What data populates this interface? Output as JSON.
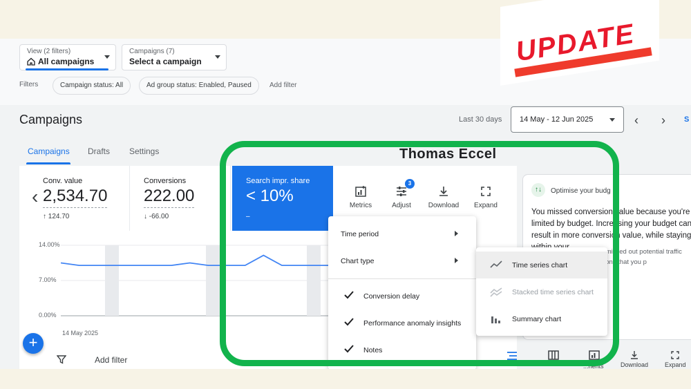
{
  "view_selector": {
    "label": "View (2 filters)",
    "value": "All campaigns"
  },
  "campaign_selector": {
    "label": "Campaigns (7)",
    "value": "Select a campaign"
  },
  "filters": {
    "label": "Filters",
    "chips": [
      "Campaign status: All",
      "Ad group status: Enabled, Paused"
    ],
    "add_filter": "Add filter"
  },
  "page_title": "Campaigns",
  "date_range": {
    "label": "Last 30 days",
    "value": "14 May - 12 Jun 2025",
    "cut_link": "S"
  },
  "tabs": [
    "Campaigns",
    "Drafts",
    "Settings"
  ],
  "metrics": [
    {
      "label": "Conv. value",
      "value": "2,534.70",
      "delta": "↑ 124.70"
    },
    {
      "label": "Conversions",
      "value": "222.00",
      "delta": "↓ -66.00"
    },
    {
      "label": "Search impr. share",
      "value": "< 10%",
      "delta": "–"
    }
  ],
  "toolbar": [
    {
      "label": "Metrics",
      "icon": "metrics-icon"
    },
    {
      "label": "Adjust",
      "icon": "adjust-icon",
      "badge": "3"
    },
    {
      "label": "Download",
      "icon": "download-icon"
    },
    {
      "label": "Expand",
      "icon": "expand-icon"
    }
  ],
  "chart": {
    "y_ticks": [
      "14.00%",
      "7.00%",
      "0.00%"
    ],
    "x_tick": "14 May 2025"
  },
  "chart_data": {
    "type": "line",
    "x": [
      "14 May 2025",
      "",
      "",
      "",
      "",
      "",
      "",
      "",
      "",
      "",
      "",
      "",
      "",
      "",
      "",
      ""
    ],
    "series": [
      {
        "values": [
          10.5,
          10.0,
          10.0,
          10.0,
          10.0,
          10.0,
          10.0,
          10.5,
          10.0,
          10.0,
          10.0,
          12.0,
          10.0,
          10.0,
          10.0,
          10.0
        ]
      }
    ],
    "ylim": [
      0,
      14
    ],
    "y_tick_labels": [
      "14.00%",
      "7.00%",
      "0.00%"
    ],
    "xlabel": "",
    "ylabel": "",
    "color": "#4285f4"
  },
  "chart_menu": {
    "items": [
      "Time period",
      "Chart type"
    ],
    "checked": [
      "Conversion delay",
      "Performance anomaly insights",
      "Notes"
    ]
  },
  "chart_type_menu": {
    "items": [
      {
        "label": "Time series chart",
        "state": "highlighted"
      },
      {
        "label": "Stacked time series chart",
        "state": "disabled"
      },
      {
        "label": "Summary chart",
        "state": "normal"
      }
    ]
  },
  "recommendation": {
    "title": "Optimise your budg",
    "body": "You missed conversion value because you're limited by budget. Increasing your budget can result in more conversion value, while staying within your",
    "small": "Over the last 7 days, you missed out potential traffic because you lost ad auctions that you p"
  },
  "bottom_bar": {
    "add_filter": "Add filter",
    "icons": [
      "Download",
      "Expand"
    ],
    "partial": "...nents"
  },
  "overlay": {
    "watermark": "Thomas Eccel",
    "update_badge": "UPDATE",
    "frame_color": "#12b34c",
    "update_color": "#e8192c"
  },
  "colors": {
    "accent": "#1a73e8",
    "background": "#f7f3e6"
  }
}
